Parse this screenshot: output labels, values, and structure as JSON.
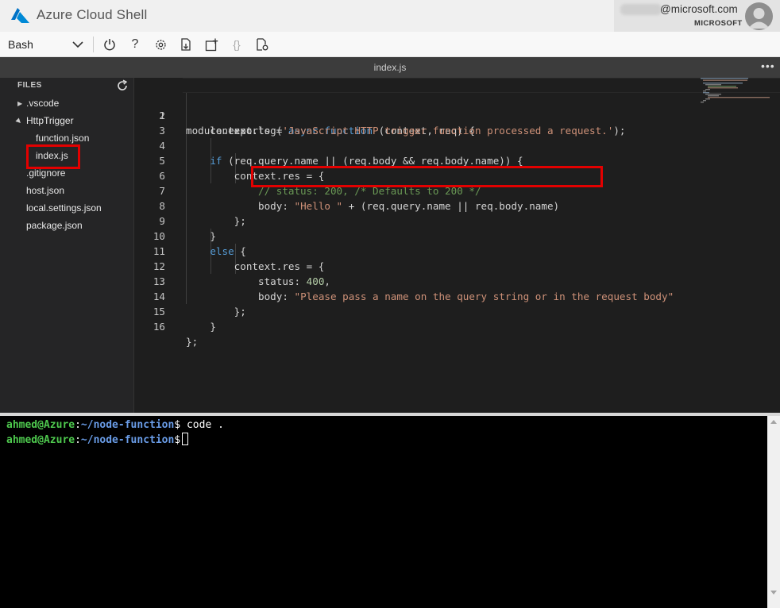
{
  "app": {
    "title": "Azure Cloud Shell",
    "account_email": "@microsoft.com",
    "account_org": "MICROSOFT"
  },
  "toolbar": {
    "shell_type": "Bash",
    "buttons": {
      "restart": "power-icon",
      "help": "?",
      "settings": "gear-icon",
      "upload": "upload-download-icon",
      "new_session": "new-session-icon",
      "editor": "{}",
      "web_preview": "web-preview-icon"
    }
  },
  "editor": {
    "open_file": "index.js",
    "more_label": "•••",
    "explorer": {
      "header": "FILES",
      "items": [
        {
          "label": ".vscode",
          "type": "folder",
          "expanded": false
        },
        {
          "label": "HttpTrigger",
          "type": "folder",
          "expanded": true
        },
        {
          "label": "function.json",
          "type": "file"
        },
        {
          "label": "index.js",
          "type": "file",
          "highlighted": true
        },
        {
          "label": ".gitignore",
          "type": "file"
        },
        {
          "label": "host.json",
          "type": "file"
        },
        {
          "label": "local.settings.json",
          "type": "file"
        },
        {
          "label": "package.json",
          "type": "file"
        }
      ]
    },
    "line_numbers": [
      "1",
      "2",
      "3",
      "4",
      "5",
      "6",
      "7",
      "8",
      "9",
      "10",
      "11",
      "12",
      "13",
      "14",
      "15",
      "16"
    ],
    "code": {
      "l1_a": "module.exports = ",
      "l1_b": "async",
      "l1_c": " ",
      "l1_d": "function",
      "l1_e": " (context, req) {",
      "l2_a": "    context.log(",
      "l2_b": "'JavaScript HTTP trigger function processed a request.'",
      "l2_c": ");",
      "l4_a": "    ",
      "l4_b": "if",
      "l4_c": " (req.query.name || (req.body && req.body.name)) {",
      "l5": "        context.res = {",
      "l6": "            // status: 200, /* Defaults to 200 */",
      "l7_a": "            body: ",
      "l7_b": "\"Hello \"",
      "l7_c": " + (req.query.name || req.body.name)",
      "l8": "        };",
      "l9": "    }",
      "l10_a": "    ",
      "l10_b": "else",
      "l10_c": " {",
      "l11": "        context.res = {",
      "l12_a": "            status: ",
      "l12_b": "400",
      "l12_c": ",",
      "l13_a": "            body: ",
      "l13_b": "\"Please pass a name on the query string or in the request body\"",
      "l14": "        };",
      "l15": "    }",
      "l16": "};"
    }
  },
  "terminal": {
    "user_host": "ahmed@Azure",
    "colon": ":",
    "path": "~/node-function",
    "prompt_symbol": "$",
    "command_1": " code .",
    "command_2": " "
  },
  "colors": {
    "accent": "#0072c6",
    "highlight": "#e30000",
    "terminal_user": "#4ec94e",
    "terminal_path": "#6a9de8",
    "keyword": "#569cd6",
    "string": "#ce9178",
    "comment": "#6a9955"
  }
}
